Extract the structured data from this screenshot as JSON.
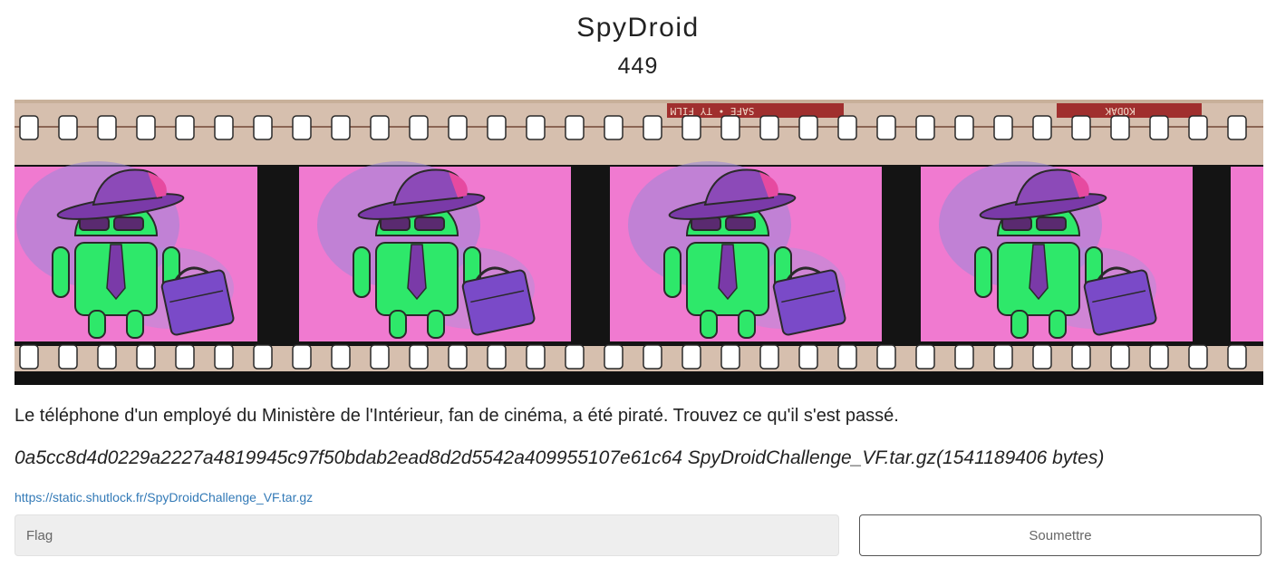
{
  "challenge": {
    "title": "SpyDroid",
    "points": "449",
    "description": "Le téléphone d'un employé du Ministère de l'Intérieur, fan de cinéma, a été piraté. Trouvez ce qu'il s'est passé.",
    "hash_line": "0a5cc8d4d0229a2227a4819945c97f50bdab2ead8d2d5542a409955107e61c64 SpyDroidChallenge_VF.tar.gz(1541189406 bytes)",
    "download_link": "https://static.shutlock.fr/SpyDroidChallenge_VF.tar.gz"
  },
  "banner": {
    "film_edge_text_1": "SAFE • TY FILM",
    "film_edge_text_2": "KODAK",
    "colors": {
      "film": "#d6bfae",
      "frame_bg": "#f07ad0",
      "robot": "#2ee86a",
      "hat": "#8c4ab8",
      "tie": "#7a3aa8"
    }
  },
  "form": {
    "flag_placeholder": "Flag",
    "submit_label": "Soumettre"
  }
}
